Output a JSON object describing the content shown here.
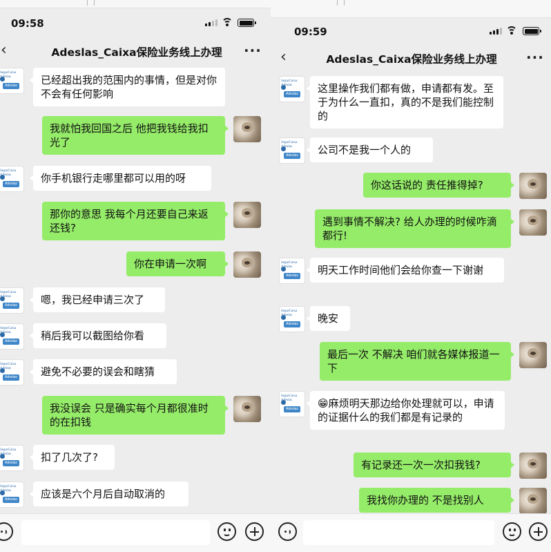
{
  "left": {
    "status_time": "09:58",
    "chat_title": "Adeslas_Caixa保险业务线上办理",
    "messages": [
      {
        "dir": "in",
        "text": "已经超出我的范围内的事情，但是对你不会有任何影响"
      },
      {
        "dir": "out",
        "text": "我就怕我回国之后 他把我钱给我扣光了"
      },
      {
        "dir": "in",
        "text": "你手机银行走哪里都可以用的呀"
      },
      {
        "dir": "out",
        "text": "那你的意思 我每个月还要自己来返还钱?"
      },
      {
        "dir": "out",
        "text": "你在申请一次啊"
      },
      {
        "dir": "in",
        "text": "嗯，我已经申请三次了"
      },
      {
        "dir": "in",
        "text": "稍后我可以截图给你看"
      },
      {
        "dir": "in",
        "text": "避免不必要的误会和瞎猜"
      },
      {
        "dir": "out",
        "text": "我没误会 只是确实每个月都很准时的在扣钱"
      },
      {
        "dir": "in",
        "text": "扣了几次了?"
      },
      {
        "dir": "in",
        "text": "应该是六个月后自动取消的"
      }
    ]
  },
  "right": {
    "status_time": "09:59",
    "chat_title": "Adeslas_Caixa保险业务线上办理",
    "messages": [
      {
        "dir": "in",
        "text": "这里操作我们都有做，申请都有发。至于为什么一直扣，真的不是我们能控制的"
      },
      {
        "dir": "in",
        "text": "公司不是我一个人的"
      },
      {
        "dir": "out",
        "text": "你这话说的 责任推得掉?"
      },
      {
        "dir": "out",
        "text": "遇到事情不解决? 给人办理的时候咋滴都行!"
      },
      {
        "dir": "in",
        "text": "明天工作时间他们会给你查一下谢谢"
      },
      {
        "dir": "in",
        "text": "晚安"
      },
      {
        "dir": "out",
        "text": "最后一次 不解决 咱们就各媒体报道一下"
      },
      {
        "dir": "in",
        "text": "😁麻烦明天那边给你处理就可以，申请的证据什么的我们都是有记录的"
      },
      {
        "dir": "out",
        "text": "有记录还一次一次扣我钱?"
      },
      {
        "dir": "out",
        "text": "我找你办理的 不是找别人"
      }
    ]
  },
  "avatar": {
    "agent_logo_text": "SegurCaixa Adeslas",
    "agent_logo_badge": "Adeslas"
  },
  "icons": {
    "back": "back-chevron-icon",
    "more": "more-dots-icon",
    "voice": "voice-icon",
    "emoji": "emoji-icon",
    "plus": "plus-icon",
    "signal": "signal-icon",
    "wifi": "wifi-icon",
    "battery": "battery-icon"
  },
  "colors": {
    "outgoing_bubble": "#95ec69",
    "incoming_bubble": "#ffffff",
    "chat_background": "#ededed"
  }
}
